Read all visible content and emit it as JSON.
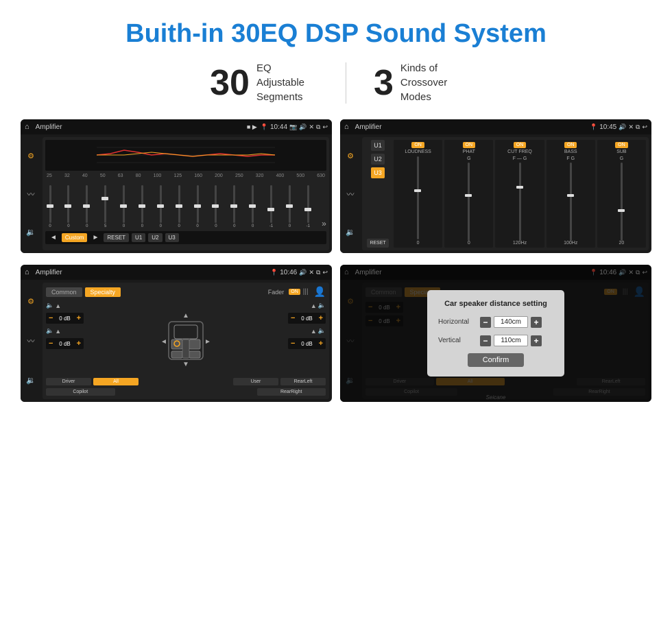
{
  "header": {
    "title": "Buith-in 30EQ DSP Sound System"
  },
  "stats": [
    {
      "number": "30",
      "label": "EQ Adjustable\nSegments"
    },
    {
      "number": "3",
      "label": "Kinds of\nCrossover Modes"
    }
  ],
  "screen_eq": {
    "topbar": {
      "home": "⌂",
      "title": "Amplifier",
      "time": "10:44"
    },
    "freq_labels": [
      "25",
      "32",
      "40",
      "50",
      "63",
      "80",
      "100",
      "125",
      "160",
      "200",
      "250",
      "320",
      "400",
      "500",
      "630"
    ],
    "sliders": [
      0,
      0,
      0,
      5,
      0,
      0,
      0,
      0,
      0,
      0,
      0,
      0,
      -1,
      0,
      -1
    ],
    "bottom_buttons": [
      "Custom",
      "RESET",
      "U1",
      "U2",
      "U3"
    ]
  },
  "screen_crossover": {
    "topbar": {
      "title": "Amplifier",
      "time": "10:45"
    },
    "u_buttons": [
      "U1",
      "U2",
      "U3"
    ],
    "active_u": "U3",
    "columns": [
      {
        "label": "LOUDNESS",
        "on": true
      },
      {
        "label": "PHAT",
        "on": true
      },
      {
        "label": "CUT FREQ",
        "on": true
      },
      {
        "label": "BASS",
        "on": true
      },
      {
        "label": "SUB",
        "on": true
      }
    ],
    "reset_label": "RESET"
  },
  "screen_specialty": {
    "topbar": {
      "title": "Amplifier",
      "time": "10:46"
    },
    "tabs": [
      "Common",
      "Specialty"
    ],
    "active_tab": "Specialty",
    "fader_label": "Fader",
    "fader_on": "ON",
    "db_controls": [
      {
        "value": "0 dB"
      },
      {
        "value": "0 dB"
      },
      {
        "value": "0 dB"
      },
      {
        "value": "0 dB"
      }
    ],
    "speaker_buttons": [
      "Driver",
      "RearLeft",
      "All",
      "User",
      "RearRight",
      "Copilot"
    ]
  },
  "screen_distance": {
    "topbar": {
      "title": "Amplifier",
      "time": "10:46"
    },
    "tabs": [
      "Common",
      "Specialty"
    ],
    "active_tab": "Specialty",
    "modal": {
      "title": "Car speaker distance setting",
      "rows": [
        {
          "label": "Horizontal",
          "value": "140cm"
        },
        {
          "label": "Vertical",
          "value": "110cm"
        }
      ],
      "confirm_label": "Confirm"
    },
    "db_controls": [
      {
        "value": "0 dB"
      },
      {
        "value": "0 dB"
      }
    ],
    "speaker_buttons": [
      "Driver",
      "RearLeft",
      "All",
      "User",
      "RearRight",
      "Copilot"
    ]
  },
  "watermark": "Seicane"
}
